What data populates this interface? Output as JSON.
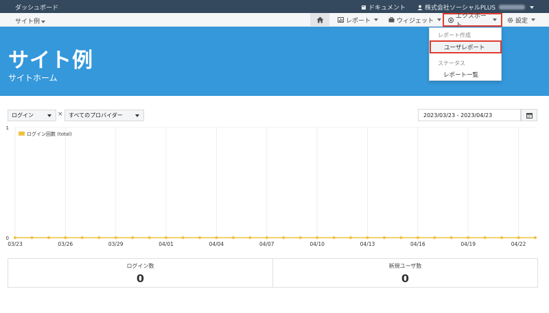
{
  "topbar": {
    "brand": "ダッシュボード",
    "docs_label": "ドキュメント",
    "company": "株式会社ソーシャルPLUS"
  },
  "subnav": {
    "site_label": "サイト例",
    "report_label": "レポート",
    "widget_label": "ウィジェット",
    "export_label": "エクスポート",
    "settings_label": "設定"
  },
  "hero": {
    "title": "サイト例",
    "subtitle": "サイトホーム"
  },
  "dropdown": {
    "header1": "レポート作成",
    "item1": "ユーザレポート",
    "header2": "ステータス",
    "item2": "レポート一覧"
  },
  "filters": {
    "metric": "ログイン",
    "times": "×",
    "provider": "すべてのプロバイダー",
    "date_range": "2023/03/23 - 2023/04/23"
  },
  "colors": {
    "hero": "#3498db",
    "topbar": "#34495e",
    "series": "#f0c040",
    "highlight": "#e03a2e"
  },
  "chart_data": {
    "type": "line",
    "x": [
      "03/23",
      "03/24",
      "03/25",
      "03/26",
      "03/27",
      "03/28",
      "03/29",
      "03/30",
      "03/31",
      "04/01",
      "04/02",
      "04/03",
      "04/04",
      "04/05",
      "04/06",
      "04/07",
      "04/08",
      "04/09",
      "04/10",
      "04/11",
      "04/12",
      "04/13",
      "04/14",
      "04/15",
      "04/16",
      "04/17",
      "04/18",
      "04/19",
      "04/20",
      "04/21",
      "04/22",
      "04/23"
    ],
    "tick_labels": [
      "03/23",
      "03/26",
      "03/29",
      "04/01",
      "04/04",
      "04/07",
      "04/10",
      "04/13",
      "04/16",
      "04/19",
      "04/22"
    ],
    "series": [
      {
        "name": "ログイン回数 (total)",
        "values": [
          0,
          0,
          0,
          0,
          0,
          0,
          0,
          0,
          0,
          0,
          0,
          0,
          0,
          0,
          0,
          0,
          0,
          0,
          0,
          0,
          0,
          0,
          0,
          0,
          0,
          0,
          0,
          0,
          0,
          0,
          0,
          0
        ]
      }
    ],
    "ylim": [
      0,
      1
    ],
    "ytick_labels": [
      "0",
      "1"
    ],
    "legend": "top-left",
    "grid": true
  },
  "stats": [
    {
      "label": "ログイン数",
      "value": "0"
    },
    {
      "label": "新規ユーザ数",
      "value": "0"
    }
  ]
}
